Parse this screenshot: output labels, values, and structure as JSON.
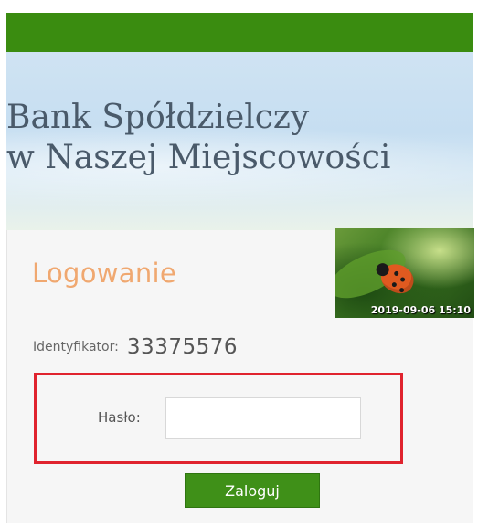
{
  "header": {
    "bank_name_line1": "Bank Spółdzielczy",
    "bank_name_line2": "w Naszej Miejscowości"
  },
  "login": {
    "title": "Logowanie",
    "photo_timestamp": "2019-09-06 15:10",
    "identifier_label": "Identyfikator:",
    "identifier_value": "33375576",
    "password_label": "Hasło:",
    "password_value": "",
    "submit_label": "Zaloguj"
  },
  "colors": {
    "brand_green": "#3a8c10",
    "login_title_orange": "#f0a870",
    "highlight_red": "#e0232e"
  }
}
